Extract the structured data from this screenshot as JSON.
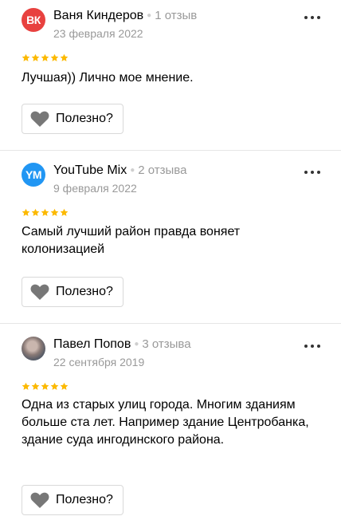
{
  "reviews": [
    {
      "avatar_initials": "ВК",
      "avatar_color": "#e8413f",
      "name": "Ваня Киндеров",
      "review_count": "1 отзыв",
      "date": "23 февраля 2022",
      "rating": 5,
      "text": "Лучшая)) Лично мое мнение.",
      "useful_label": "Полезно?"
    },
    {
      "avatar_initials": "YM",
      "avatar_color": "#2196f3",
      "name": "YouTube Mix",
      "review_count": "2 отзыва",
      "date": "9 февраля 2022",
      "rating": 5,
      "text": "Самый лучший район правда воняет колонизацией",
      "useful_label": "Полезно?"
    },
    {
      "avatar_initials": "",
      "avatar_color": "",
      "name": "Павел Попов",
      "review_count": "3 отзыва",
      "date": "22 сентября 2019",
      "rating": 5,
      "text": "Одна из старых улиц города. Многим зданиям больше ста лет. Например здание Центробанка, здание суда ингодинского района.",
      "useful_label": "Полезно?"
    }
  ],
  "icons": {
    "more": "more-dots-icon",
    "star": "star-icon",
    "useful": "heart-icon"
  },
  "colors": {
    "star": "#fcb900",
    "heart": "#777777",
    "secondary_text": "#999999"
  }
}
